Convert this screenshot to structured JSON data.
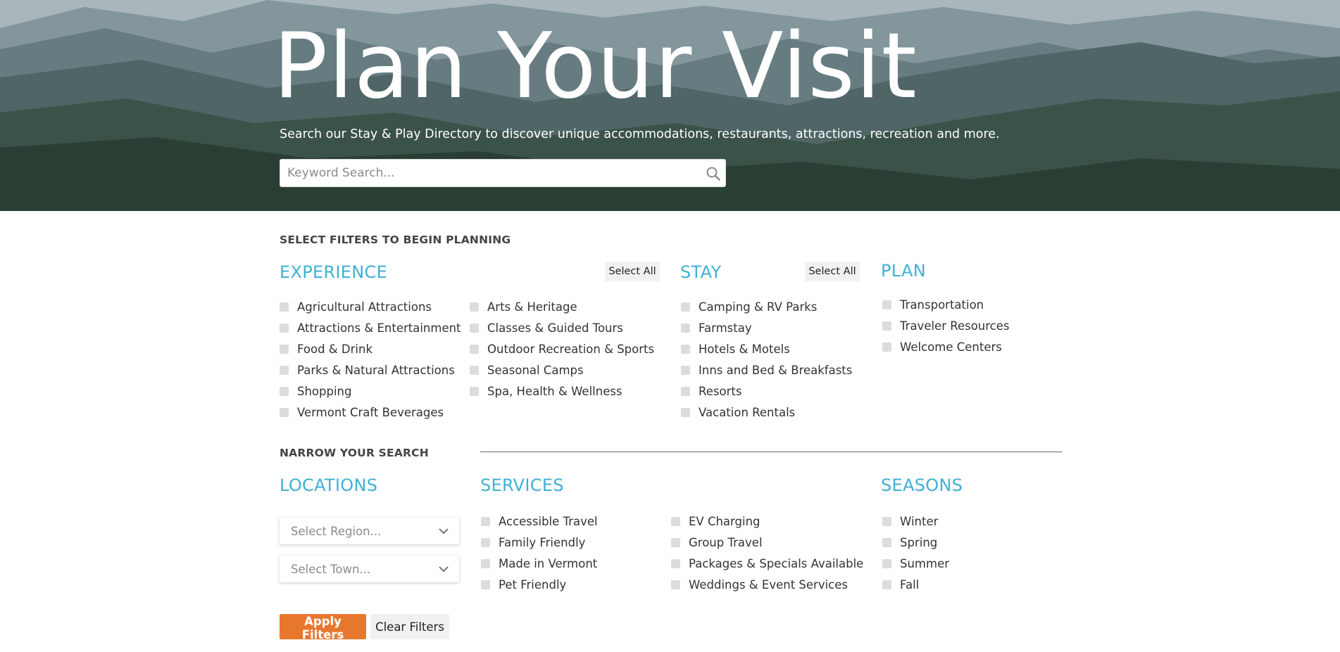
{
  "hero": {
    "title": "Plan Your Visit",
    "subtitle": "Search our Stay & Play Directory to discover unique accommodations, restaurants, attractions, recreation and more.",
    "search_placeholder": "Keyword Search..."
  },
  "filters": {
    "heading": "SELECT FILTERS TO BEGIN PLANNING",
    "select_all_label": "Select All",
    "experience": {
      "title": "EXPERIENCE",
      "col1": [
        "Agricultural Attractions",
        "Attractions & Entertainment",
        "Food & Drink",
        "Parks & Natural Attractions",
        "Shopping",
        "Vermont Craft Beverages"
      ],
      "col2": [
        "Arts & Heritage",
        "Classes & Guided Tours",
        "Outdoor Recreation & Sports",
        "Seasonal Camps",
        "Spa, Health & Wellness"
      ]
    },
    "stay": {
      "title": "STAY",
      "items": [
        "Camping & RV Parks",
        "Farmstay",
        "Hotels & Motels",
        "Inns and Bed & Breakfasts",
        "Resorts",
        "Vacation Rentals"
      ]
    },
    "plan": {
      "title": "PLAN",
      "items": [
        "Transportation",
        "Traveler Resources",
        "Welcome Centers"
      ]
    }
  },
  "narrow": {
    "heading": "NARROW YOUR SEARCH",
    "locations": {
      "title": "LOCATIONS",
      "region_placeholder": "Select Region...",
      "town_placeholder": "Select Town..."
    },
    "services": {
      "title": "SERVICES",
      "col1": [
        "Accessible Travel",
        "Family Friendly",
        "Made in Vermont",
        "Pet Friendly"
      ],
      "col2": [
        "EV Charging",
        "Group Travel",
        "Packages & Specials Available",
        "Weddings & Event Services"
      ]
    },
    "seasons": {
      "title": "SEASONS",
      "items": [
        "Winter",
        "Spring",
        "Summer",
        "Fall"
      ]
    }
  },
  "actions": {
    "apply_label": "Apply Filters",
    "clear_label": "Clear Filters"
  },
  "colors": {
    "accent_blue": "#3fb0d4",
    "apply_orange": "#e8772e",
    "checkbox_gray": "#dcdcdc"
  },
  "icons": {
    "search": "search-icon",
    "dropdown": "chevron-down-icon"
  }
}
